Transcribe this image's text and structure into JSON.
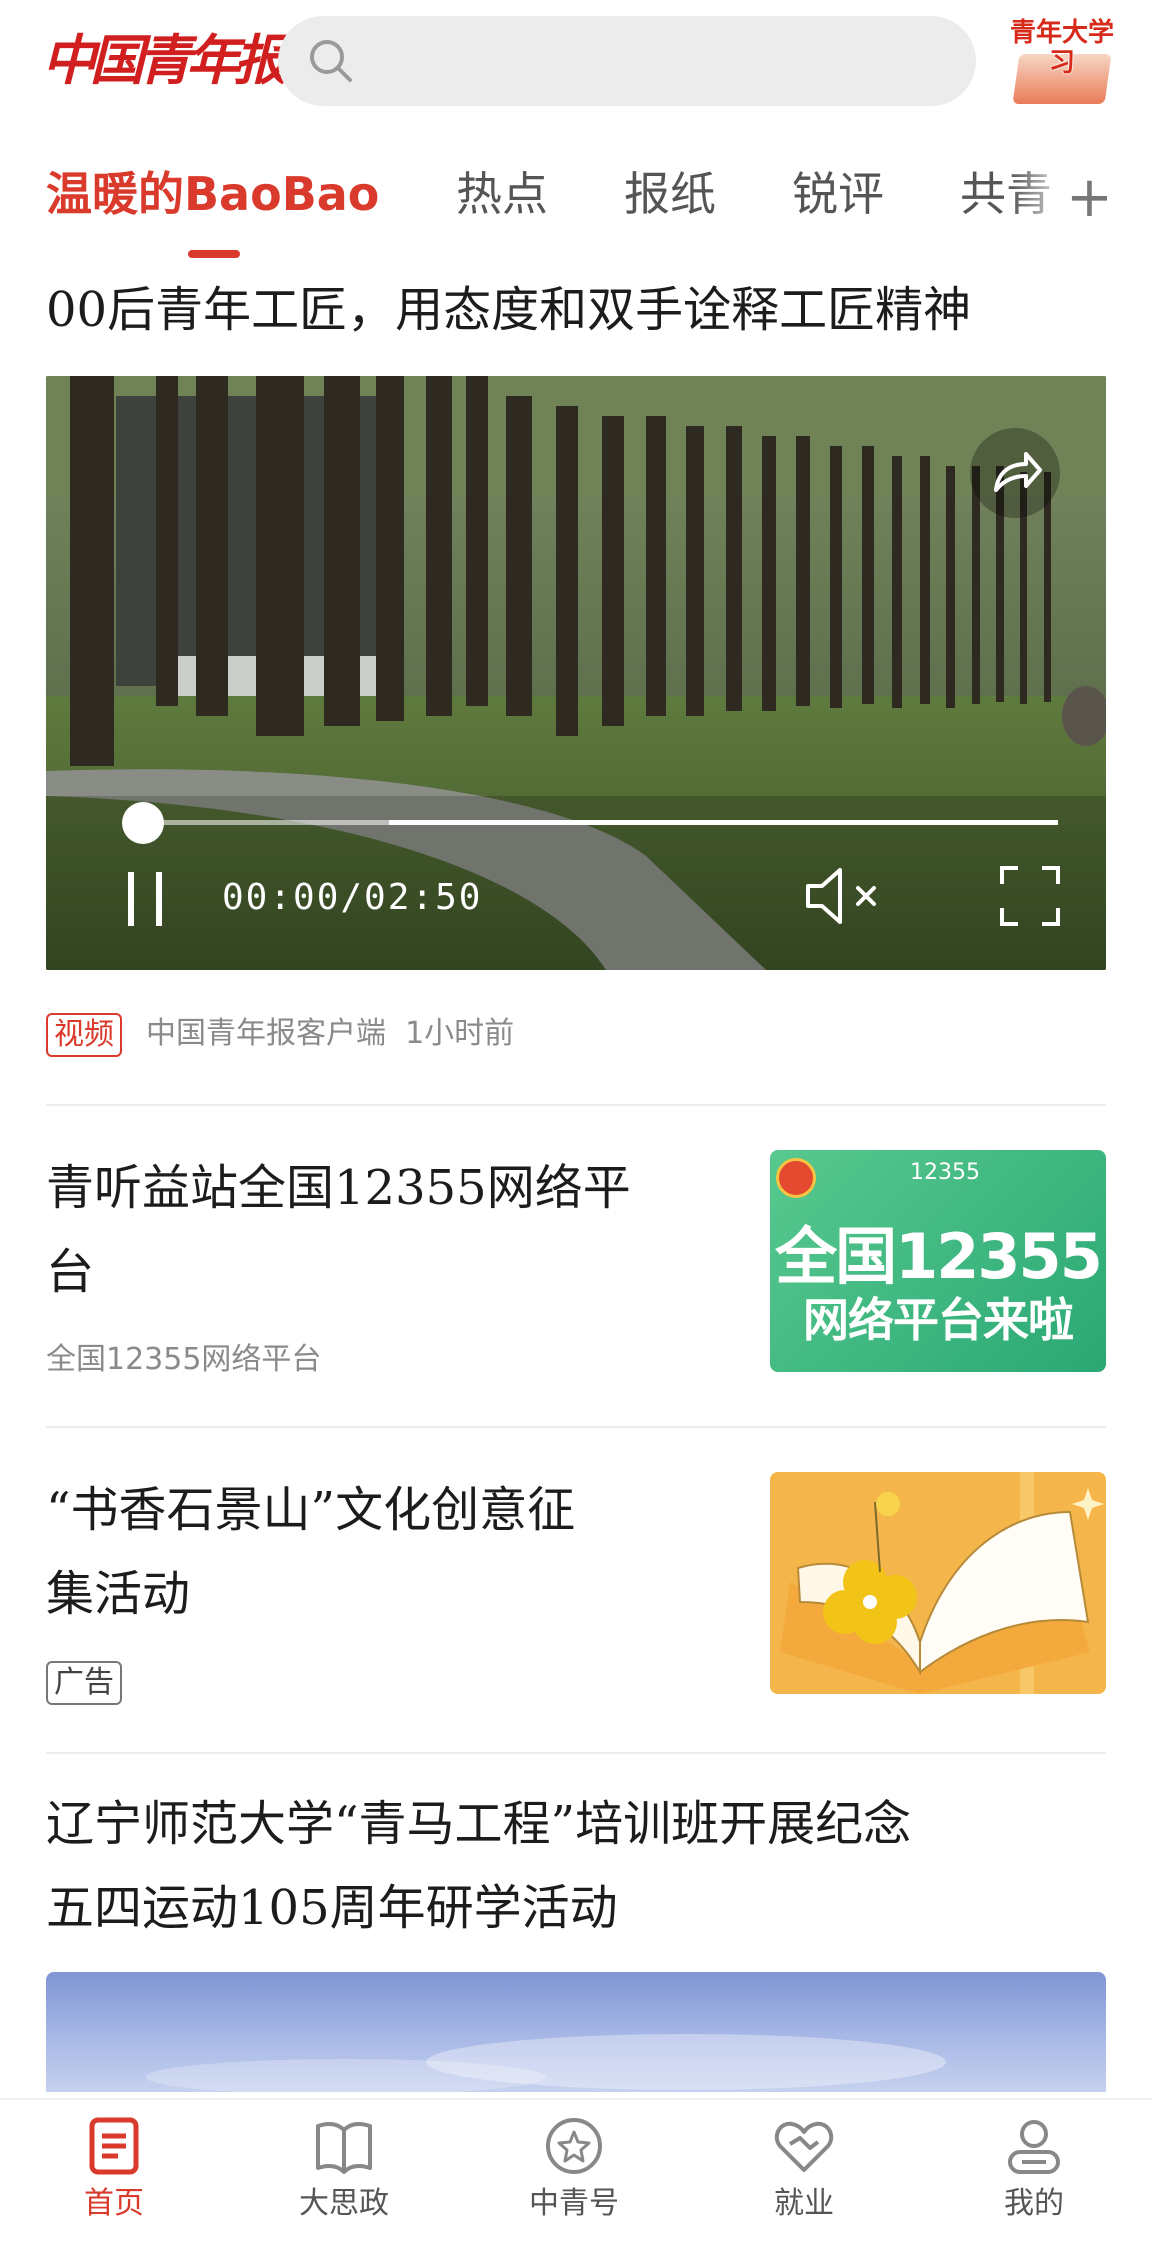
{
  "header": {
    "logo_text": "中国青年报",
    "search_placeholder": "",
    "study_badge": "青年大学习"
  },
  "tabs": [
    {
      "label": "温暖的BaoBao",
      "active": true
    },
    {
      "label": "热点",
      "active": false
    },
    {
      "label": "报纸",
      "active": false
    },
    {
      "label": "锐评",
      "active": false
    },
    {
      "label": "共青",
      "active": false
    }
  ],
  "tabs_more": "+",
  "feed": [
    {
      "type": "video",
      "title": "00后青年工匠，用态度和双手诠释工匠精神",
      "video": {
        "time": "00:00/02:50",
        "played_fraction": 0.0,
        "buffered_fraction": 0.27
      },
      "tag": "视频",
      "source": "中国青年报客户端",
      "time": "1小时前"
    },
    {
      "type": "article",
      "title_lines": [
        "青听益站全国12355网络平",
        "台"
      ],
      "source": "全国12355网络平台",
      "thumb": {
        "top": "12355",
        "big": "全国12355",
        "small": "网络平台来啦"
      }
    },
    {
      "type": "ad",
      "title_lines": [
        "“书香石景山”文化创意征",
        "集活动"
      ],
      "tag": "广告"
    },
    {
      "type": "photo",
      "title_lines": [
        "辽宁师范大学“青马工程”培训班开展纪念",
        "五四运动105周年研学活动"
      ]
    }
  ],
  "bottom_nav": [
    {
      "label": "首页",
      "icon": "home-doc-icon",
      "active": true
    },
    {
      "label": "大思政",
      "icon": "open-book-icon",
      "active": false
    },
    {
      "label": "中青号",
      "icon": "star-badge-icon",
      "active": false
    },
    {
      "label": "就业",
      "icon": "heart-handshake-icon",
      "active": false
    },
    {
      "label": "我的",
      "icon": "user-icon",
      "active": false
    }
  ],
  "colors": {
    "accent": "#d93a2b",
    "logo": "#d11f1f"
  }
}
